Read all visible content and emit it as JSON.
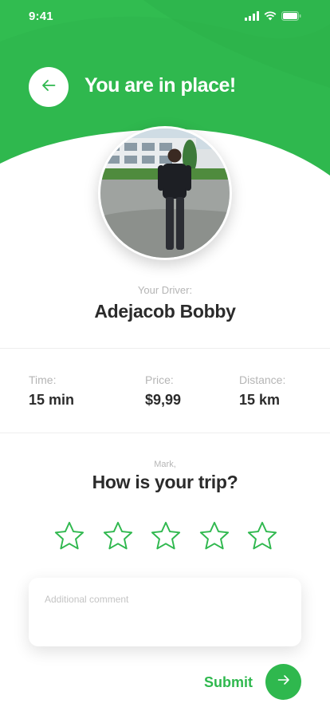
{
  "colors": {
    "accent": "#2fb84e",
    "accent_dark": "#28a843",
    "text_primary": "#2b2b2b",
    "text_muted": "#b5b5b5"
  },
  "status_bar": {
    "time": "9:41",
    "icons": [
      "signal-icon",
      "wifi-icon",
      "battery-icon"
    ]
  },
  "header": {
    "title": "You are in place!",
    "back_icon": "arrow-left-icon"
  },
  "driver": {
    "caption": "Your Driver:",
    "name": "Adejacob Bobby"
  },
  "trip_stats": [
    {
      "label": "Time:",
      "value": "15 min"
    },
    {
      "label": "Price:",
      "value": "$9,99"
    },
    {
      "label": "Distance:",
      "value": "15 km"
    }
  ],
  "rating": {
    "caption": "Mark,",
    "question": "How is your trip?",
    "max_stars": 5,
    "selected": 0
  },
  "comment": {
    "placeholder": "Additional comment",
    "value": ""
  },
  "submit": {
    "label": "Submit",
    "icon": "arrow-right-icon"
  }
}
